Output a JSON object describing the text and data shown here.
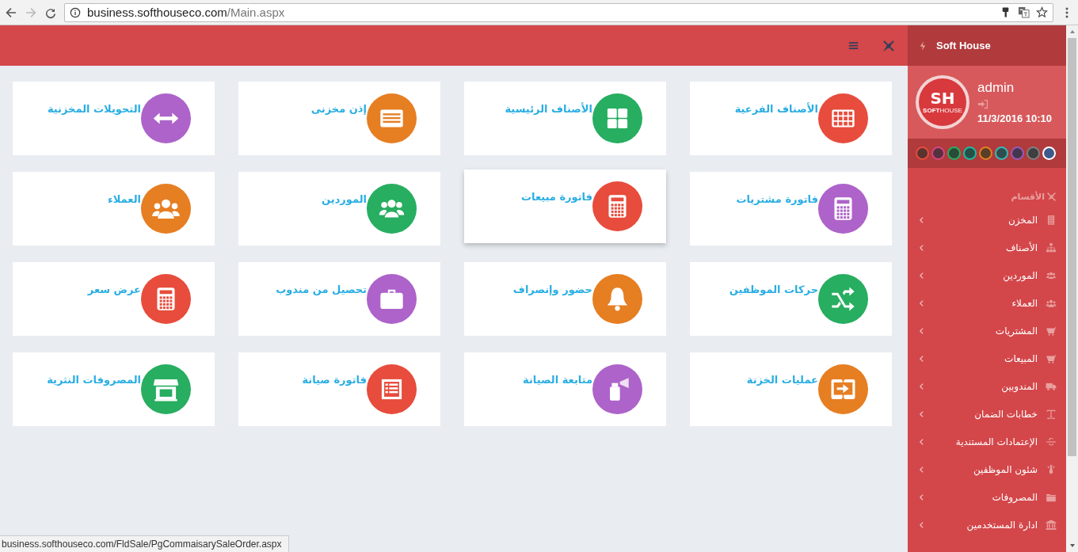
{
  "browser": {
    "url_host": "business.softhouseco.com",
    "url_path": "/Main.aspx",
    "status_url": "business.softhouseco.com/FldSale/PgCommaisarySaleOrder.aspx"
  },
  "sidebar": {
    "brand": "Soft House",
    "user": {
      "logo_initials": "SH",
      "logo_caption_bold": "SOFT",
      "logo_caption": "HOUSE",
      "name": "admin",
      "datetime": "11/3/2016 10:10"
    },
    "themes": [
      {
        "color": "#e74c3c",
        "selected": false
      },
      {
        "color": "#d6457e",
        "selected": false
      },
      {
        "color": "#27ae60",
        "selected": false
      },
      {
        "color": "#1abc9c",
        "selected": false
      },
      {
        "color": "#e67e22",
        "selected": false
      },
      {
        "color": "#3bb7b7",
        "selected": false
      },
      {
        "color": "#9b59b6",
        "selected": false
      },
      {
        "color": "#7f7f7f",
        "selected": false
      },
      {
        "color": "#3d5a8a",
        "selected": true
      }
    ],
    "section": "الأقسام",
    "items": [
      {
        "label": "المخزن",
        "kind": "building"
      },
      {
        "label": "الأصناف",
        "kind": "sitemap"
      },
      {
        "label": "الموردين",
        "kind": "users"
      },
      {
        "label": "العملاء",
        "kind": "group"
      },
      {
        "label": "المشتريات",
        "kind": "basket"
      },
      {
        "label": "المبيعات",
        "kind": "basket"
      },
      {
        "label": "المندوبين",
        "kind": "truck"
      },
      {
        "label": "خطابات الضمان",
        "kind": "text"
      },
      {
        "label": "الإعتمادات المستندية",
        "kind": "strike"
      },
      {
        "label": "شئون الموظفين",
        "kind": "tie"
      },
      {
        "label": "المصروفات",
        "kind": "folder"
      },
      {
        "label": "ادارة المستخدمين",
        "kind": "bank"
      }
    ]
  },
  "tiles": [
    {
      "label": "الأصناف الفرعية",
      "kind": "table",
      "color": "#e74c3c",
      "hovered": false
    },
    {
      "label": "الأصناف الرئيسية",
      "kind": "tiles",
      "color": "#27ae60",
      "hovered": false
    },
    {
      "label": "إذن مخزنى",
      "kind": "card",
      "color": "#e67e22",
      "hovered": false
    },
    {
      "label": "التحويلات المخزنية",
      "kind": "arrows",
      "color": "#ad63c9",
      "hovered": false
    },
    {
      "label": "فاتورة مشتريات",
      "kind": "calculator",
      "color": "#ad63c9",
      "hovered": false
    },
    {
      "label": "فاتورة مبيعات",
      "kind": "calculator",
      "color": "#e74c3c",
      "hovered": true
    },
    {
      "label": "الموردين",
      "kind": "users",
      "color": "#27ae60",
      "hovered": false
    },
    {
      "label": "العملاء",
      "kind": "group",
      "color": "#e67e22",
      "hovered": false
    },
    {
      "label": "حركات الموظفين",
      "kind": "shuffle",
      "color": "#27ae60",
      "hovered": false
    },
    {
      "label": "حضور وإنصراف",
      "kind": "bell",
      "color": "#e67e22",
      "hovered": false
    },
    {
      "label": "تحصيل من مندوب",
      "kind": "briefcase",
      "color": "#ad63c9",
      "hovered": false
    },
    {
      "label": "عرض سعر",
      "kind": "calculator",
      "color": "#e74c3c",
      "hovered": false
    },
    {
      "label": "عمليات الخزنة",
      "kind": "exchange",
      "color": "#e67e22",
      "hovered": false
    },
    {
      "label": "متابعة الصيانة",
      "kind": "spray",
      "color": "#ad63c9",
      "hovered": false
    },
    {
      "label": "فاتورة صيانة",
      "kind": "list",
      "color": "#e74c3c",
      "hovered": false
    },
    {
      "label": "المصروفات النثرية",
      "kind": "store",
      "color": "#27ae60",
      "hovered": false
    }
  ]
}
